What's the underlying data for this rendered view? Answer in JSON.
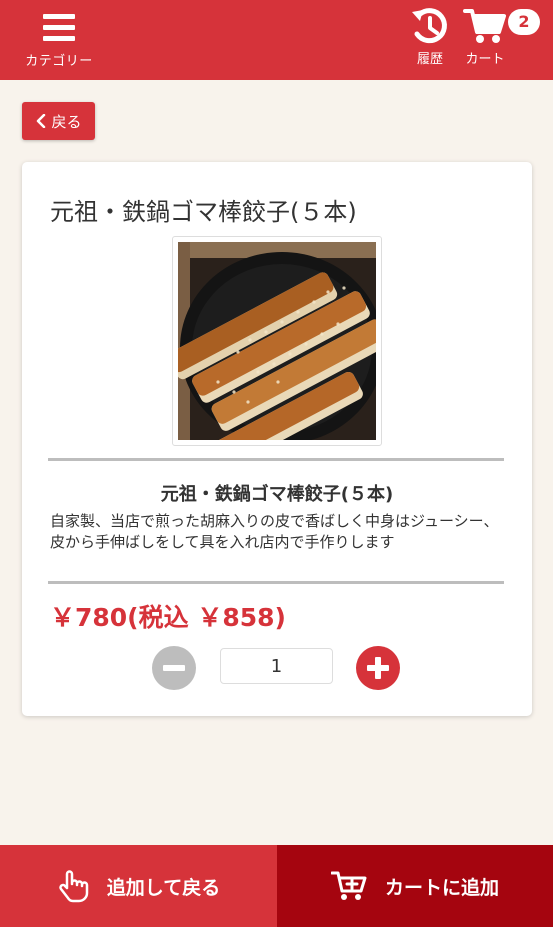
{
  "header": {
    "menu_label": "カテゴリー",
    "history_label": "履歴",
    "cart_label": "カート",
    "cart_count": "2"
  },
  "back_label": "戻る",
  "product": {
    "title": "元祖・鉄鍋ゴマ棒餃子(５本)",
    "subtitle": "元祖・鉄鍋ゴマ棒餃子(５本)",
    "description": "自家製、当店で煎った胡麻入りの皮で香ばしく中身はジューシー、皮から手伸ばしをして具を入れ店内で手作りします",
    "price": "￥780(税込 ￥858)",
    "quantity": "1",
    "image_icon": "gyoza-photo"
  },
  "footer": {
    "add_back_label": "追加して戻る",
    "add_cart_label": "カートに追加"
  },
  "colors": {
    "primary": "#d6333a",
    "dark_primary": "#a5050f",
    "background": "#f8f3ec",
    "disabled": "#bdbdbd"
  }
}
